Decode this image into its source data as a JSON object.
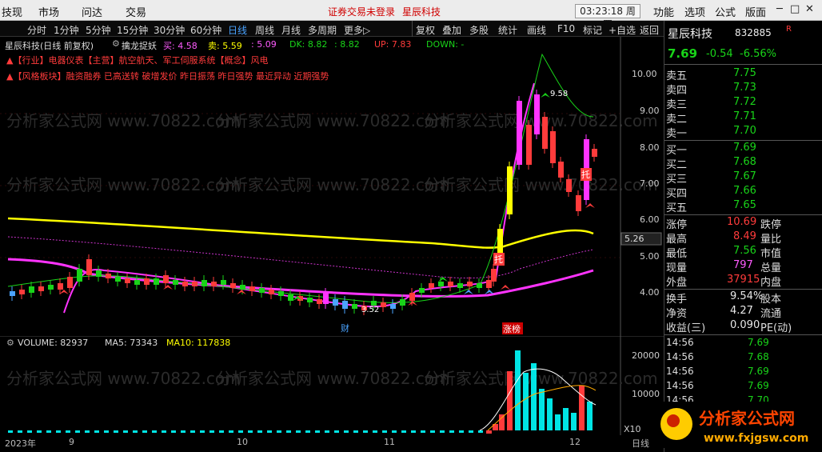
{
  "menubar": {
    "items": [
      "技现",
      "市场",
      "问达",
      "交易"
    ],
    "alert": "证券交易未登录",
    "stock_name": "星辰科技",
    "clock": "03:23:18 周四",
    "right_items": [
      "功能",
      "选项",
      "公式",
      "版面"
    ],
    "win_buttons": [
      "─",
      "□",
      "✕"
    ]
  },
  "periodbar": {
    "items": [
      "分时",
      "1分钟",
      "5分钟",
      "15分钟",
      "30分钟",
      "60分钟",
      "日线",
      "周线",
      "月线",
      "多周期",
      "更多▷"
    ],
    "active": "日线",
    "tools": [
      "复权",
      "叠加",
      "多股",
      "统计",
      "画线",
      "F10",
      "标记",
      "+自选",
      "返回"
    ]
  },
  "chart_info": {
    "title": "星辰科技(日线 前复权)",
    "indicator": "擒龙捉妖",
    "buy_label": "买: 4.58",
    "sell_label": "卖: 5.59",
    "val3": ": 5.09",
    "dk_label": "DK: 8.82",
    "dk2": ": 8.82",
    "up_label": "UP: 7.83",
    "down_label": "DOWN: -",
    "industry_line": "▲【行业】电器仪表【主营】航空航天、军工伺服系统【概念】风电",
    "style_line": "▲【风格板块】融资融券 已高送转 破增发价 昨日振荡 昨日强势 最近异动 近期强势"
  },
  "price_axis": [
    "10.00",
    "9.00",
    "8.00",
    "7.00",
    "6.00",
    "5.00",
    "4.00"
  ],
  "price_marker": "5.26",
  "chart_labels": {
    "high": "9.58",
    "low": "3.52",
    "tuo": "托",
    "cai": "财",
    "zhangbang": "涨榜"
  },
  "volume_info": {
    "volume": "VOLUME: 82937",
    "ma5": "MA5: 73343",
    "ma10": "MA10: 117838"
  },
  "vol_axis": [
    "20000",
    "10000"
  ],
  "vol_unit": "X10",
  "x_axis": [
    "2023年",
    "9",
    "10",
    "11",
    "12"
  ],
  "period_tag": "日线",
  "watermark": "分析家公式网 www.70822.com",
  "quote": {
    "name": "星辰科技",
    "code": "832885",
    "badge": "R",
    "price": "7.69",
    "change": "-0.54",
    "pct": "-6.56%",
    "asks": [
      {
        "label": "卖五",
        "price": "7.75"
      },
      {
        "label": "卖四",
        "price": "7.73"
      },
      {
        "label": "卖三",
        "price": "7.72"
      },
      {
        "label": "卖二",
        "price": "7.71"
      },
      {
        "label": "卖一",
        "price": "7.70"
      }
    ],
    "bids": [
      {
        "label": "买一",
        "price": "7.69"
      },
      {
        "label": "买二",
        "price": "7.68"
      },
      {
        "label": "买三",
        "price": "7.67"
      },
      {
        "label": "买四",
        "price": "7.66"
      },
      {
        "label": "买五",
        "price": "7.65"
      }
    ],
    "stats": [
      {
        "k": "涨停",
        "v": "10.69",
        "k2": "跌停",
        "color": "red"
      },
      {
        "k": "最高",
        "v": "8.49",
        "k2": "量比",
        "color": "red"
      },
      {
        "k": "最低",
        "v": "7.56",
        "k2": "市值",
        "color": "green"
      },
      {
        "k": "现量",
        "v": "797",
        "k2": "总量",
        "color": "purple"
      },
      {
        "k": "外盘",
        "v": "37915",
        "k2": "内盘",
        "color": "red"
      }
    ],
    "stats2": [
      {
        "k": "换手",
        "v": "9.54%",
        "k2": "股本"
      },
      {
        "k": "净资",
        "v": "4.27",
        "k2": "流通"
      },
      {
        "k": "收益(三)",
        "v": "0.090",
        "k2": "PE(动)"
      }
    ],
    "ticks": [
      {
        "t": "14:56",
        "p": "7.69"
      },
      {
        "t": "14:56",
        "p": "7.68"
      },
      {
        "t": "14:56",
        "p": "7.69"
      },
      {
        "t": "14:56",
        "p": "7.69"
      },
      {
        "t": "14:56",
        "p": "7.70"
      }
    ]
  },
  "logo": {
    "title": "分析家公式网",
    "url": "www.fxjgsw.com"
  },
  "colors": {
    "up": "#ff3b3b",
    "down": "#19d419",
    "ma_yellow": "#ffff00",
    "ma_magenta": "#ff33ff",
    "accent_blue": "#4aa3ff"
  }
}
